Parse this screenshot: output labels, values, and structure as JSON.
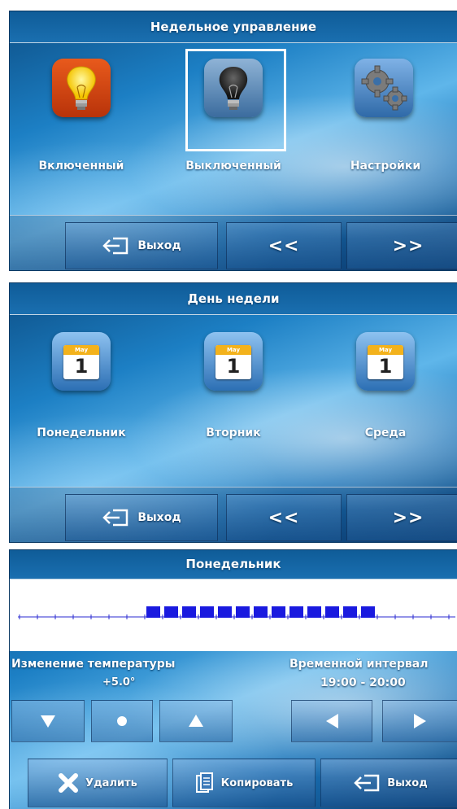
{
  "screen1": {
    "title": "Недельное управление",
    "tiles": [
      {
        "label": "Включенный",
        "icon": "bulb-on-icon"
      },
      {
        "label": "Выключенный",
        "icon": "bulb-off-icon",
        "selected": true
      },
      {
        "label": "Настройки",
        "icon": "gears-icon"
      }
    ],
    "exit_label": "Выход",
    "prev_label": "<<",
    "next_label": ">>"
  },
  "screen2": {
    "title": "День недели",
    "calendar_month": "May",
    "calendar_day": "1",
    "tiles": [
      {
        "label": "Понедельник",
        "icon": "calendar-icon"
      },
      {
        "label": "Вторник",
        "icon": "calendar-icon"
      },
      {
        "label": "Среда",
        "icon": "calendar-icon"
      }
    ],
    "exit_label": "Выход",
    "prev_label": "<<",
    "next_label": ">>"
  },
  "screen3": {
    "title": "Понедельник",
    "schedule": {
      "slots_total": 24,
      "active_from": 7,
      "active_to": 20,
      "color": "#1a1adf"
    },
    "temp_change_label": "Изменение температуры",
    "temp_change_value": "+5.0°",
    "interval_label": "Временной интервал",
    "interval_value": "19:00 - 20:00",
    "delete_label": "Удалить",
    "copy_label": "Копировать",
    "exit_label": "Выход"
  },
  "colors": {
    "accent_blue": "#1a73b8",
    "schedule_blue": "#1a1adf"
  }
}
